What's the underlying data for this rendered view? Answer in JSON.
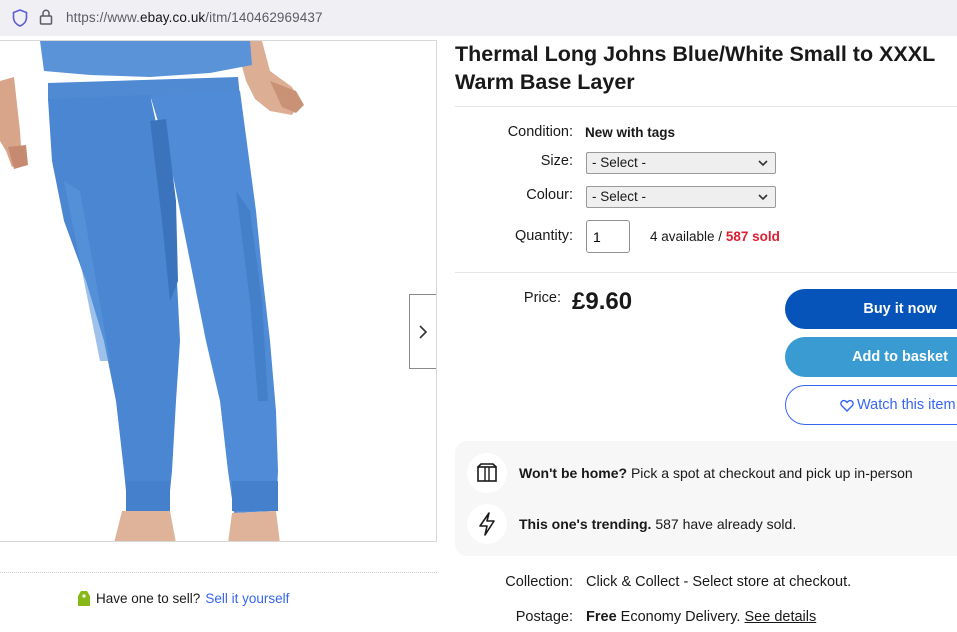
{
  "browser": {
    "url_prefix": "https://www.",
    "url_host": "ebay.co.uk",
    "url_path": "/itm/140462969437"
  },
  "sell": {
    "question": "Have one to sell?",
    "link": "Sell it yourself"
  },
  "listing": {
    "title_line1": "Thermal Long Johns Blue/White Small to XXXL",
    "title_line2": "Warm Base Layer"
  },
  "details": {
    "condition_label": "Condition:",
    "condition_value": "New with tags",
    "size_label": "Size:",
    "size_selected": "- Select -",
    "colour_label": "Colour:",
    "colour_selected": "- Select -",
    "quantity_label": "Quantity:",
    "quantity_value": "1",
    "available": "4 available",
    "separator": " / ",
    "sold": "587 sold"
  },
  "pricing": {
    "label": "Price:",
    "value": "£9.60",
    "buy_now": "Buy it now",
    "add_to_basket": "Add to basket",
    "watch": "Watch this item"
  },
  "promos": {
    "pickup_bold": "Won't be home?",
    "pickup_text": " Pick a spot at checkout and pick up in-person",
    "trending_bold": "This one's trending.",
    "trending_text": " 587 have already sold."
  },
  "shipping": {
    "collection_label": "Collection:",
    "collection_value": "Click & Collect - Select store at checkout.",
    "postage_label": "Postage:",
    "postage_value_bold": "Free",
    "postage_value": " Economy Delivery.",
    "postage_link": "See details"
  },
  "colors": {
    "buy_button": "#0654ba",
    "basket_button": "#3a9bd2",
    "link": "#3665f3",
    "sold": "#dd1e31",
    "product_blue": "#4a86d2"
  },
  "icons": [
    "shield-icon",
    "lock-icon",
    "chevron-right-icon",
    "chevron-down-icon",
    "tag-icon",
    "heart-icon",
    "box-icon",
    "lightning-icon"
  ]
}
